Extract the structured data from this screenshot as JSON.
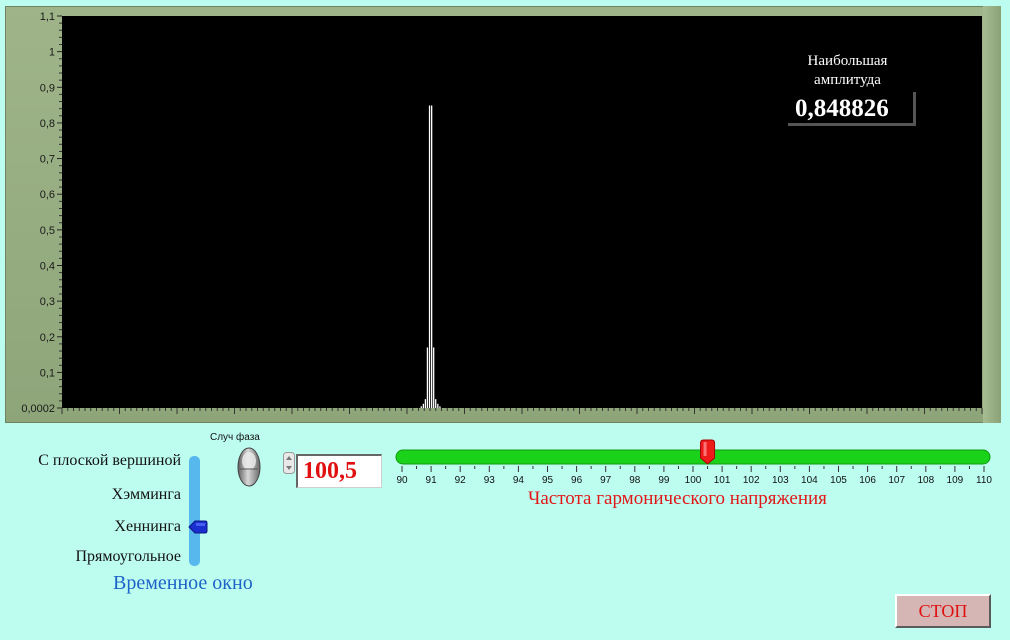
{
  "graph": {
    "amplitude_label_line1": "Наибольшая",
    "amplitude_label_line2": "амплитуда",
    "amplitude_value": "0,848826",
    "plot_bg": "#000000",
    "frame_color": "#9fb589"
  },
  "chart_data": {
    "type": "bar",
    "x_range": [
      0,
      1
    ],
    "ylim": [
      0.0002,
      1.1
    ],
    "y_tick_labels": [
      "0,0002",
      "0,1",
      "0,2",
      "0,3",
      "0,4",
      "0,5",
      "0,6",
      "0,7",
      "0,8",
      "0,9",
      "1",
      "1,1"
    ],
    "y_tick_values": [
      0.0002,
      0.1,
      0.2,
      0.3,
      0.4,
      0.5,
      0.6,
      0.7,
      0.8,
      0.9,
      1.0,
      1.1
    ],
    "grid": false,
    "peaks": [
      {
        "x": 0.3905,
        "y": 0.005
      },
      {
        "x": 0.3928,
        "y": 0.012
      },
      {
        "x": 0.395,
        "y": 0.025
      },
      {
        "x": 0.3972,
        "y": 0.17
      },
      {
        "x": 0.3995,
        "y": 0.848826
      },
      {
        "x": 0.4018,
        "y": 0.848826
      },
      {
        "x": 0.404,
        "y": 0.17
      },
      {
        "x": 0.4062,
        "y": 0.025
      },
      {
        "x": 0.4085,
        "y": 0.012
      },
      {
        "x": 0.4108,
        "y": 0.005
      }
    ],
    "series_color": "#ffffff"
  },
  "window": {
    "title": "Временное окно",
    "options": [
      "С плоской вершиной",
      "Хэмминга",
      "Хеннинга",
      "Прямоугольное"
    ],
    "selected": "Хеннинга",
    "slider_color": "#57b8ee",
    "thumb_color": "#1a2fd0"
  },
  "phase": {
    "label": "Случ фаза"
  },
  "frequency": {
    "value": "100,5",
    "title": "Частота гармонического напряжения",
    "min": 90,
    "max": 110,
    "current": 100.5,
    "tick_labels": [
      "90",
      "91",
      "92",
      "93",
      "94",
      "95",
      "96",
      "97",
      "98",
      "99",
      "100",
      "101",
      "102",
      "103",
      "104",
      "105",
      "106",
      "107",
      "108",
      "109",
      "110"
    ],
    "track_color": "#1bd21b",
    "thumb_color": "#ee1b1b"
  },
  "stop_button": {
    "label": "СТОП"
  }
}
